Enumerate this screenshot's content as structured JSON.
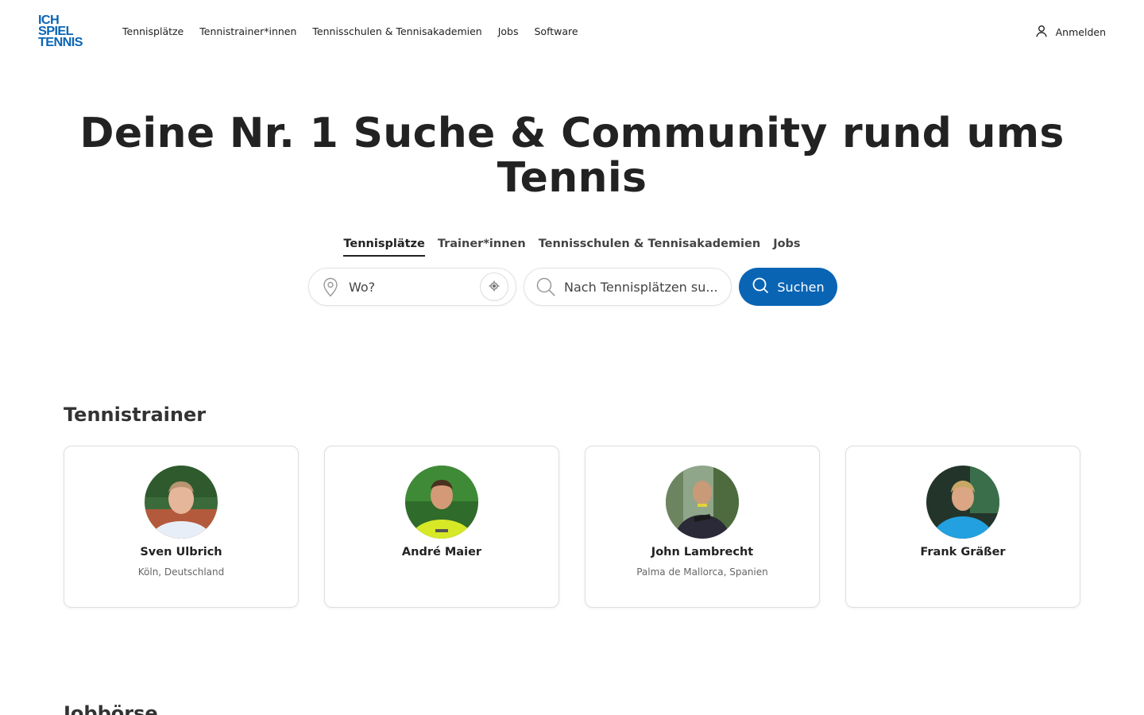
{
  "logo": {
    "lines": [
      "ICH",
      "SPIEL",
      "TENNIS"
    ]
  },
  "nav": {
    "items": [
      {
        "label": "Tennisplätze"
      },
      {
        "label": "Tennistrainer*innen"
      },
      {
        "label": "Tennisschulen & Tennisakademien"
      },
      {
        "label": "Jobs"
      },
      {
        "label": "Software"
      }
    ],
    "login_label": "Anmelden"
  },
  "hero": {
    "title_line1": "Deine Nr. 1 Suche & Community rund ums",
    "title_line2": "Tennis"
  },
  "search": {
    "tabs": [
      {
        "label": "Tennisplätze",
        "active": true
      },
      {
        "label": "Trainer*innen",
        "active": false
      },
      {
        "label": "Tennisschulen & Tennisakademien",
        "active": false
      },
      {
        "label": "Jobs",
        "active": false
      }
    ],
    "where_placeholder": "Wo?",
    "what_placeholder": "Nach Tennisplätzen su...",
    "button_label": "Suchen"
  },
  "trainers": {
    "title": "Tennistrainer",
    "items": [
      {
        "name": "Sven Ulbrich",
        "location": "Köln, Deutschland"
      },
      {
        "name": "André Maier",
        "location": ""
      },
      {
        "name": "John Lambrecht",
        "location": "Palma de Mallorca, Spanien"
      },
      {
        "name": "Frank Gräßer",
        "location": ""
      }
    ]
  },
  "next_section": {
    "title": "Jobbörse"
  },
  "colors": {
    "brand": "#0a64b4",
    "text": "#222222",
    "border": "#dedede"
  },
  "icons": {
    "login": "user-icon",
    "where": "map-pin-icon",
    "locate": "crosshair-icon",
    "what": "search-icon",
    "button": "search-icon"
  }
}
